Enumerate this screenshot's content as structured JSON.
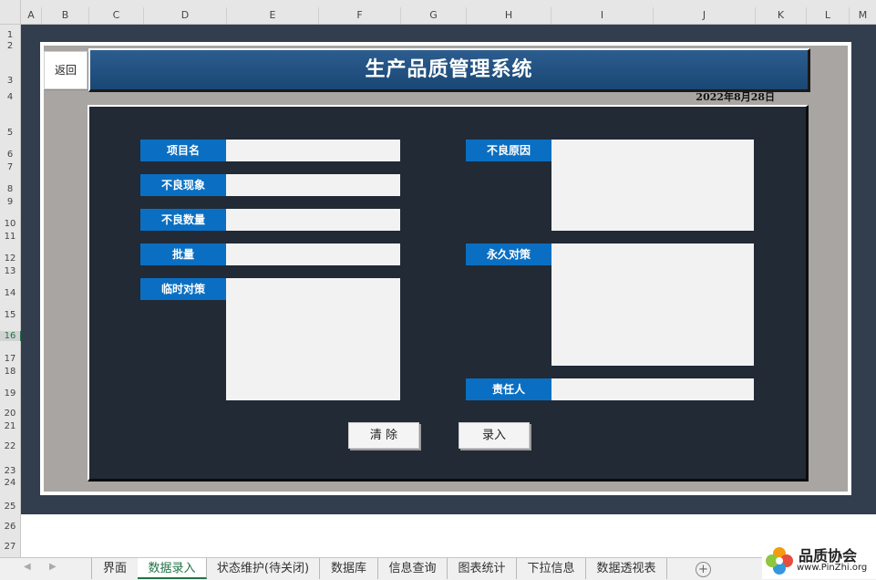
{
  "columns": [
    "A",
    "B",
    "C",
    "D",
    "E",
    "F",
    "G",
    "H",
    "I",
    "J",
    "K",
    "L",
    "M"
  ],
  "rows": [
    "1",
    "2",
    "3",
    "4",
    "5",
    "6",
    "7",
    "8",
    "9",
    "10",
    "11",
    "12",
    "13",
    "14",
    "15",
    "16",
    "17",
    "18",
    "19",
    "20",
    "21",
    "22",
    "23",
    "24",
    "25",
    "26",
    "27"
  ],
  "app": {
    "back_label": "返回",
    "title": "生产品质管理系统",
    "date": "2022年8月28日"
  },
  "form": {
    "project_name_label": "项目名",
    "defect_phenomenon_label": "不良现象",
    "defect_qty_label": "不良数量",
    "batch_label": "批量",
    "temp_measure_label": "临时对策",
    "defect_cause_label": "不良原因",
    "permanent_measure_label": "永久对策",
    "responsible_label": "责任人",
    "clear_label": "清 除",
    "submit_label": "录入"
  },
  "tabs": [
    "界面",
    "数据录入",
    "状态维护(待关闭)",
    "数据库",
    "信息查询",
    "图表统计",
    "下拉信息",
    "数据透视表"
  ],
  "active_tab": "数据录入",
  "logo": {
    "name": "品质协会",
    "url": "www.PinZhi.org"
  },
  "colors": {
    "title_bar": "#1f4e79",
    "label_bg": "#0a6fc2",
    "panel_bg": "#212a35",
    "sheet_bg": "#323e4d",
    "active_tab": "#217346"
  }
}
